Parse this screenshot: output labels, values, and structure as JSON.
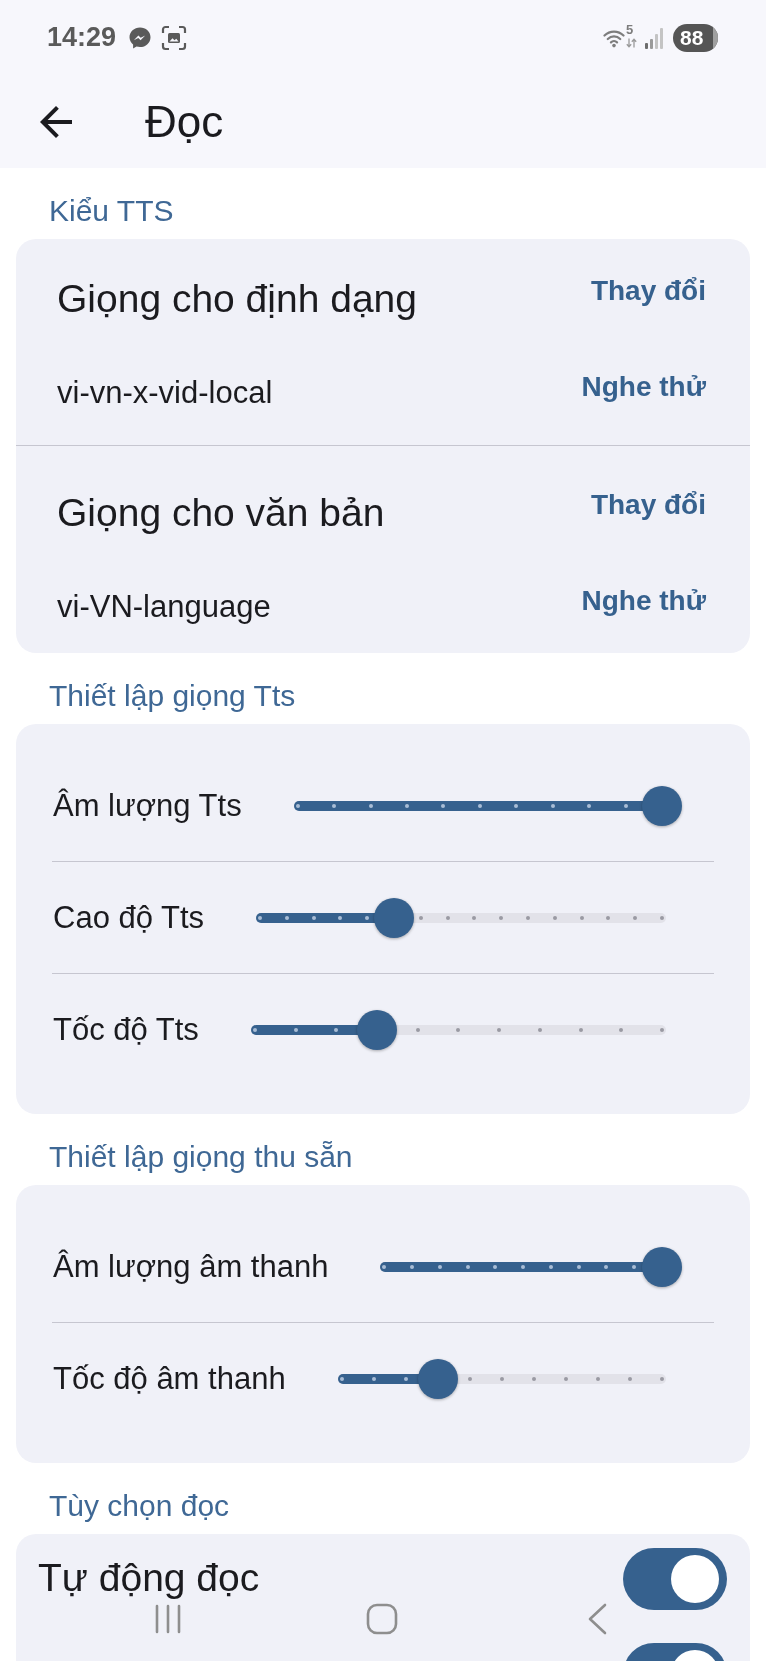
{
  "status_bar": {
    "time": "14:29",
    "wifi_band": "5",
    "battery": "88"
  },
  "app_bar": {
    "title": "Đọc"
  },
  "sections": [
    {
      "kind": "voices",
      "header": "Kiểu TTS",
      "voices": [
        {
          "title": "Giọng cho định dạng",
          "voice": "vi-vn-x-vid-local",
          "change_button": "Thay đổi",
          "preview_button": "Nghe thử"
        },
        {
          "title": "Giọng cho văn bản",
          "voice": "vi-VN-language",
          "change_button": "Thay đổi",
          "preview_button": "Nghe thử"
        }
      ]
    },
    {
      "kind": "sliders",
      "header": "Thiết lập giọng Tts",
      "sliders": [
        {
          "label": "Âm lượng Tts",
          "level": 1
        },
        {
          "label": "Cao độ Tts",
          "level": 0.333
        },
        {
          "label": "Tốc độ Tts",
          "level": 0.3
        }
      ]
    },
    {
      "kind": "sliders",
      "header": "Thiết lập giọng thu sẵn",
      "sliders": [
        {
          "label": "Âm lượng âm thanh",
          "level": 1
        },
        {
          "label": "Tốc độ âm thanh",
          "level": 0.3
        }
      ]
    },
    {
      "kind": "toggles",
      "header": "Tùy chọn đọc",
      "options": [
        {
          "label": "Tự động đọc",
          "on": true
        },
        {
          "on": true
        }
      ]
    }
  ]
}
